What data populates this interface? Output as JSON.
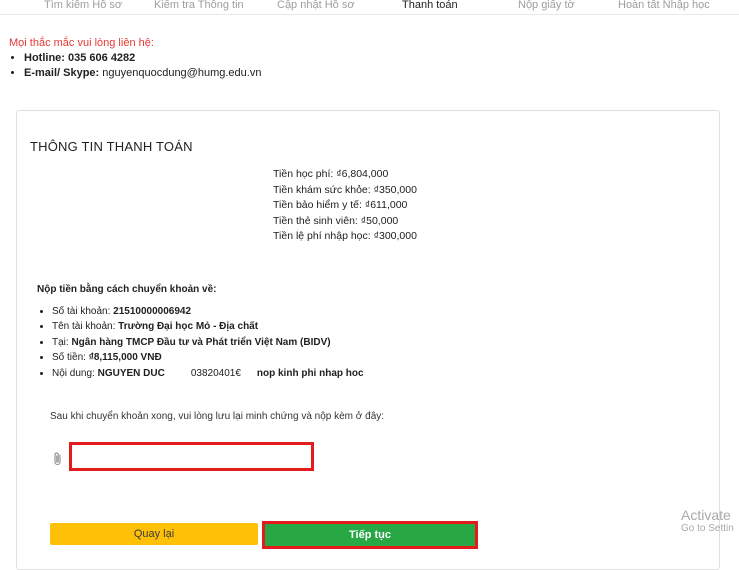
{
  "stepper": {
    "steps": [
      {
        "label": "Tìm kiếm Hồ sơ",
        "active": false
      },
      {
        "label": "Kiểm tra Thông tin",
        "active": false
      },
      {
        "label": "Cập nhật Hồ sơ",
        "active": false
      },
      {
        "label": "Thanh toán",
        "active": true
      },
      {
        "label": "Nộp giấy tờ",
        "active": false
      },
      {
        "label": "Hoàn tất Nhập học",
        "active": false
      }
    ]
  },
  "contact": {
    "note": "Mọi thắc mắc vui lòng liên hệ:",
    "hotline_label": "Hotline: ",
    "hotline_value": "035 606 4282",
    "email_label": "E-mail/ Skype: ",
    "email_value": "nguyenquocdung@humg.edu.vn"
  },
  "card": {
    "title": "THÔNG TIN THANH TOÁN",
    "fees": [
      "Tiền học phí: ₫6,804,000",
      "Tiền khám sức khỏe: ₫350,000",
      "Tiền bảo hiểm y tế: ₫611,000",
      "Tiền thẻ sinh viên: ₫50,000",
      "Tiền lệ phí nhập học: ₫300,000"
    ],
    "transfer": {
      "heading": "Nộp tiền bằng cách chuyển khoản về:",
      "account_no_label": "Số tài khoản: ",
      "account_no_value": "21510000006942",
      "account_name_label": "Tên tài khoản: ",
      "account_name_value": "Trường Đại học Mỏ - Địa chất",
      "bank_label": "Tại: ",
      "bank_value": "Ngân hàng TMCP Đầu tư và Phát triển Việt Nam (BIDV)",
      "amount_label": "Số tiền: ",
      "amount_value": "₫8,115,000 VNĐ",
      "content_label": "Nội dung: ",
      "content_name": "NGUYEN DUC",
      "content_id": "0382040​1€",
      "content_suffix": "nop kinh phi nhap hoc"
    },
    "upload_instruction": "Sau khi chuyển khoản xong, vui lòng lưu lại minh chứng và nộp kèm ở đây:",
    "back_label": "Quay lại",
    "next_label": "Tiếp tục"
  },
  "watermark": {
    "line1": "Activate",
    "line2": "Go to Settin"
  }
}
